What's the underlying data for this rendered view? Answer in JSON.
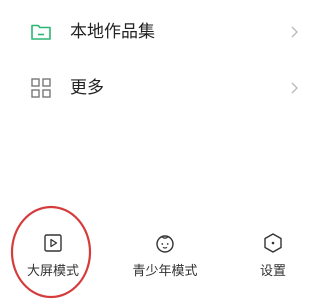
{
  "menu": {
    "items": [
      {
        "label": "本地作品集",
        "icon": "folder-icon"
      },
      {
        "label": "更多",
        "icon": "grid-icon"
      }
    ]
  },
  "bottom_nav": {
    "items": [
      {
        "label": "大屏模式",
        "icon": "play-screen-icon"
      },
      {
        "label": "青少年模式",
        "icon": "child-face-icon"
      },
      {
        "label": "设置",
        "icon": "hexagon-settings-icon"
      }
    ]
  },
  "colors": {
    "accent_green": "#2bb673",
    "icon_gray": "#777777",
    "highlight_red": "#d63b3b",
    "chevron_gray": "#bbbbbb"
  }
}
